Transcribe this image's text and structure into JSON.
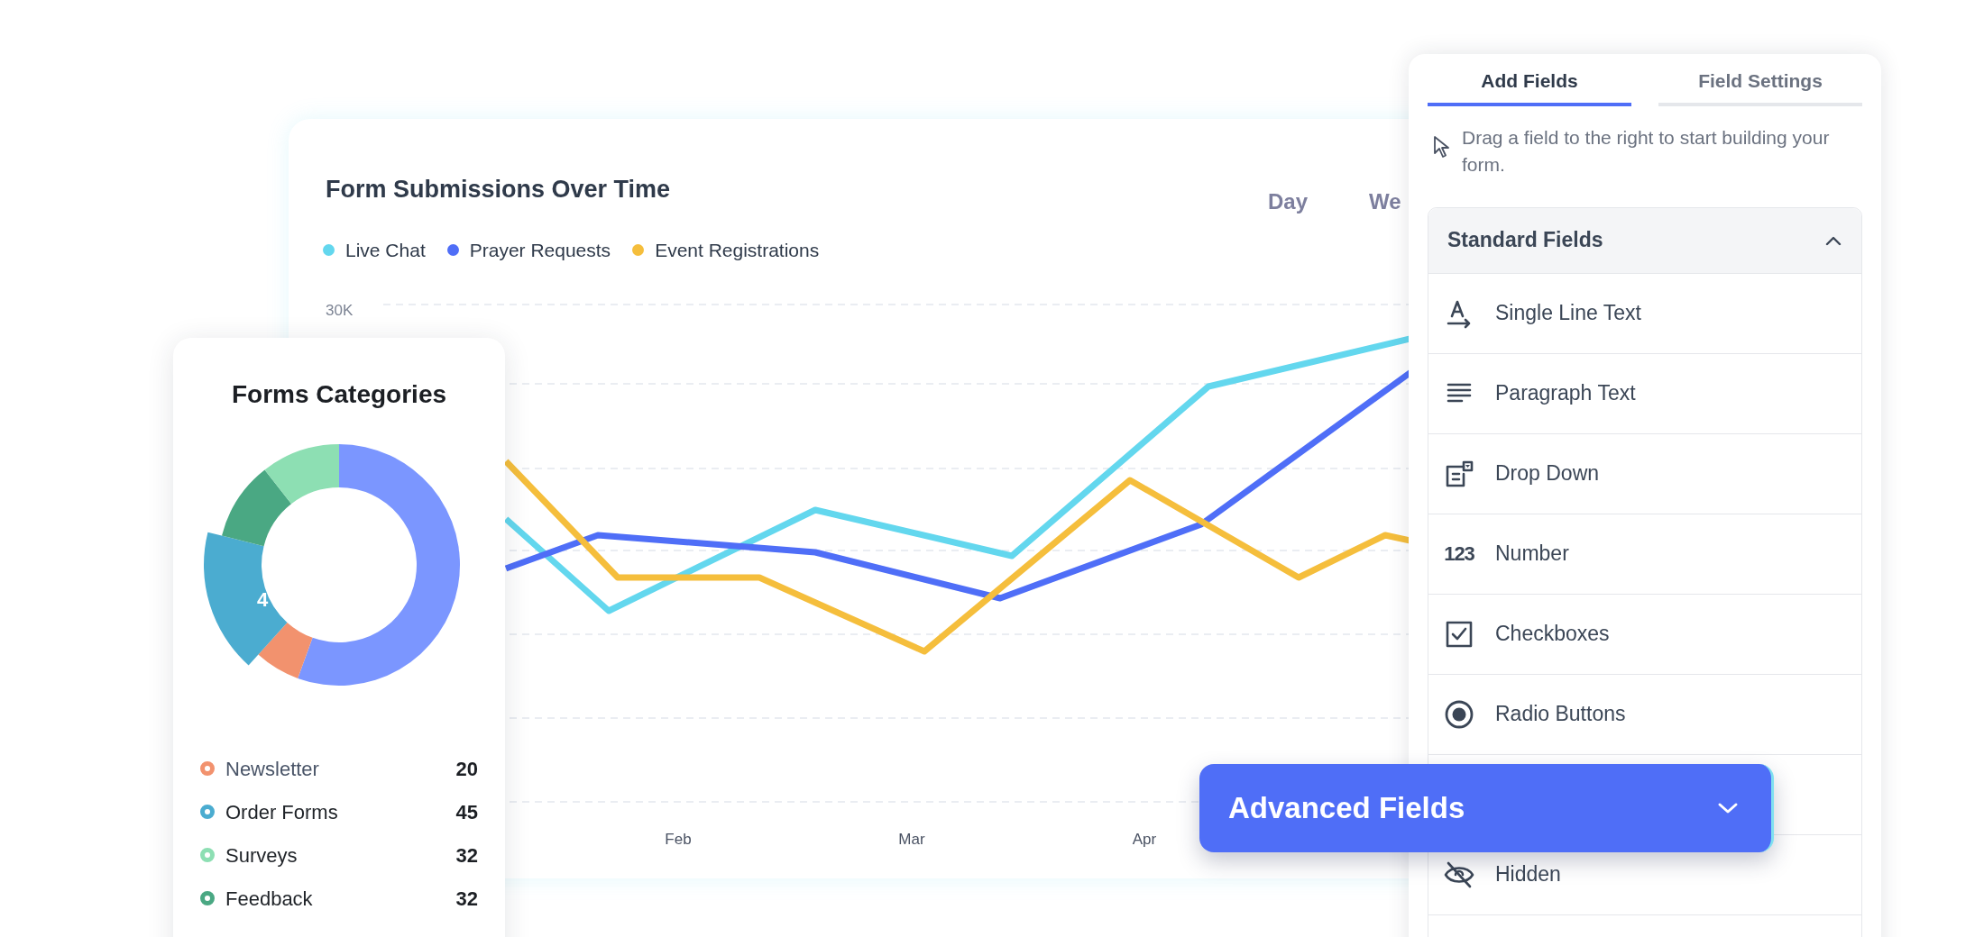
{
  "chart_card": {
    "title": "Form Submissions Over Time",
    "range_tabs": [
      "Day",
      "We"
    ],
    "legend": [
      {
        "name": "Live Chat",
        "color": "#63d7ee"
      },
      {
        "name": "Prayer Requests",
        "color": "#4f6ef7"
      },
      {
        "name": "Event Registrations",
        "color": "#f5be3c"
      }
    ],
    "y_tick": "30K",
    "x_labels": [
      "Feb",
      "Mar",
      "Apr"
    ]
  },
  "categories_card": {
    "title": "Forms Categories",
    "slice_label": "4",
    "legend": [
      {
        "name": "Newsletter",
        "value": "20",
        "color": "#f2926e"
      },
      {
        "name": "Order Forms",
        "value": "45",
        "color": "#4bacd0"
      },
      {
        "name": "Surveys",
        "value": "32",
        "color": "#8ddfb3"
      },
      {
        "name": "Feedback",
        "value": "32",
        "color": "#4aa883"
      }
    ]
  },
  "fields_panel": {
    "tabs": [
      {
        "label": "Add Fields",
        "selected": true
      },
      {
        "label": "Field Settings",
        "selected": false
      }
    ],
    "hint": "Drag a field to the right to start building your form.",
    "section": {
      "title": "Standard Fields",
      "expanded": true
    },
    "fields": [
      {
        "kind": "text",
        "label": "Single Line Text"
      },
      {
        "kind": "paragraph",
        "label": "Paragraph Text"
      },
      {
        "kind": "dropdown",
        "label": "Drop Down"
      },
      {
        "kind": "number",
        "icon_text": "123",
        "label": "Number"
      },
      {
        "kind": "checkbox",
        "label": "Checkboxes"
      },
      {
        "kind": "radio",
        "label": "Radio Buttons"
      },
      {
        "kind": "blank"
      },
      {
        "kind": "hidden",
        "label": "Hidden"
      }
    ]
  },
  "advanced_button": {
    "label": "Advanced Fields",
    "expanded": false
  }
}
